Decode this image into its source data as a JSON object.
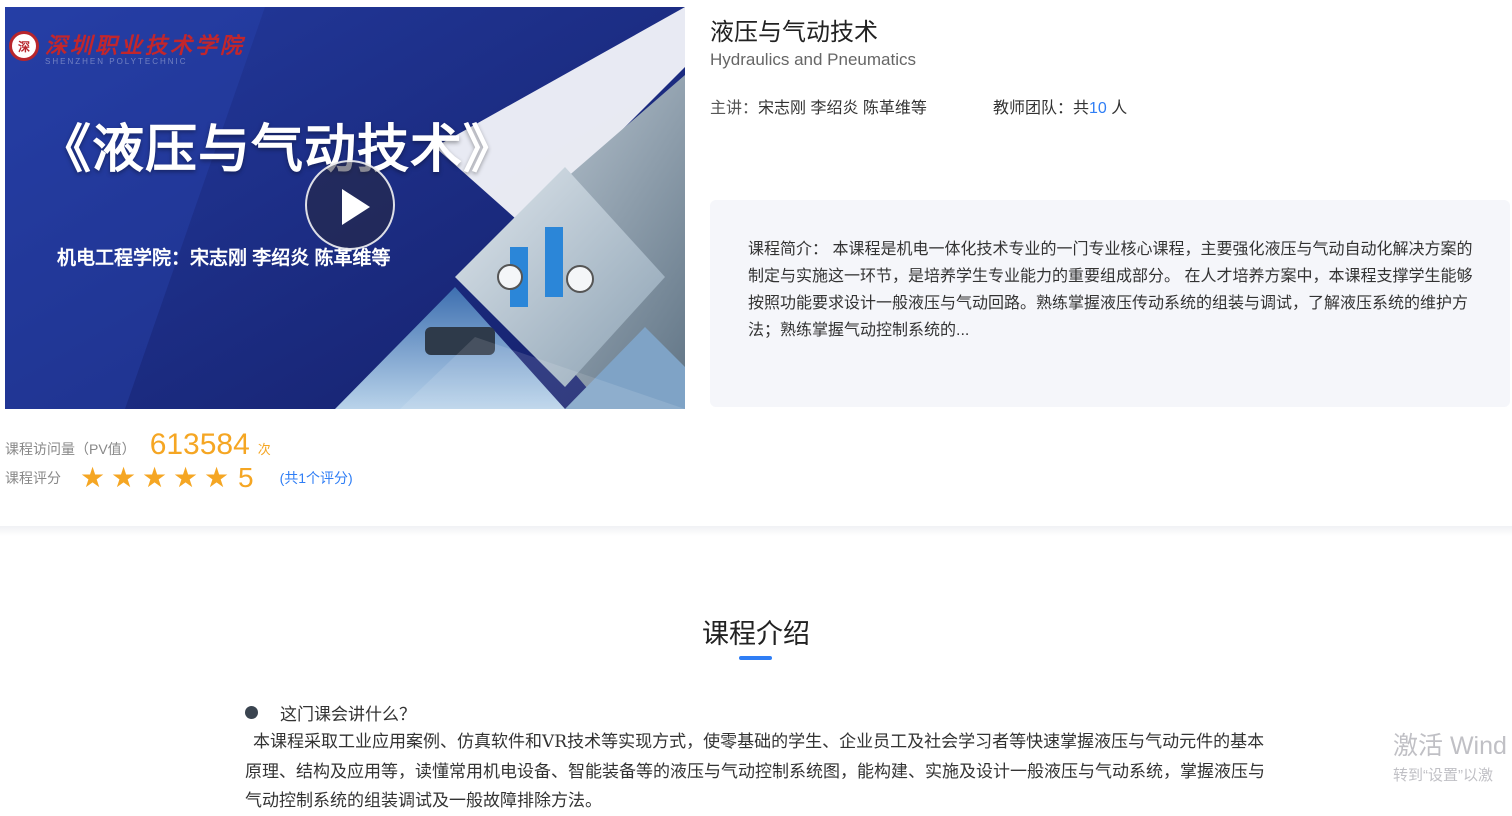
{
  "cover": {
    "school_name": "深圳职业技术学院",
    "school_en": "SHENZHEN POLYTECHNIC",
    "title": "《液压与气动技术》",
    "subtitle": "机电工程学院：宋志刚 李绍炎 陈革维等",
    "play_icon": "play-icon"
  },
  "course": {
    "title": "液压与气动技术",
    "title_en": "Hydraulics and Pneumatics",
    "lecturer_label": "主讲：",
    "lecturer_names": "宋志刚 李绍炎 陈革维等",
    "team_label": "教师团队：",
    "team_prefix": "共",
    "team_count": "10",
    "team_suffix": " 人",
    "intro": "课程简介： 本课程是机电一体化技术专业的一门专业核心课程，主要强化液压与气动自动化解决方案的制定与实施这一环节，是培养学生专业能力的重要组成部分。 在人才培养方案中，本课程支撑学生能够按照功能要求设计一般液压与气动回路。熟练掌握液压传动系统的组装与调试，了解液压系统的维护方法；熟练掌握气动控制系统的..."
  },
  "stats": {
    "pv_label": "课程访问量（PV值）",
    "pv_value": "613584",
    "pv_unit": "次",
    "rating_label": "课程评分",
    "rating_stars": 5,
    "rating_value": "5",
    "rating_count": "(共1个评分)"
  },
  "section": {
    "title": "课程介绍",
    "question": "这门课会讲什么？",
    "body": "本课程采取工业应用案例、仿真软件和VR技术等实现方式，使零基础的学生、企业员工及社会学习者等快速掌握液压与气动元件的基本原理、结构及应用等，读懂常用机电设备、智能装备等的液压与气动控制系统图，能构建、实施及设计一般液压与气动系统，掌握液压与气动控制系统的组装调试及一般故障排除方法。"
  },
  "watermark": {
    "line1": "激活 Wind",
    "line2": "转到“设置”以激"
  },
  "colors": {
    "accent": "#2f7ef5",
    "rating": "#f5a623",
    "cover_blue": "#1d2c86"
  }
}
